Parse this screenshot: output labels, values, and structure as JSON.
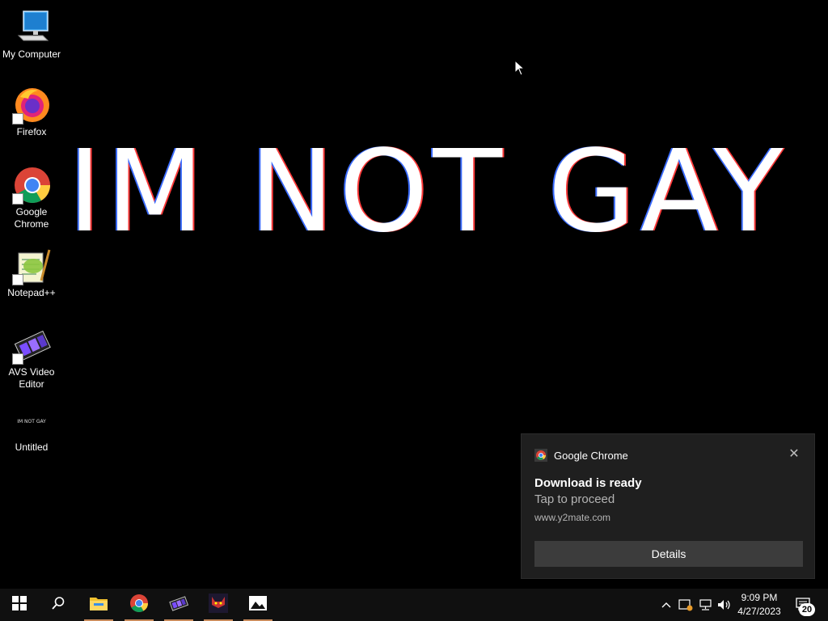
{
  "wallpaper": {
    "text": "IM NOT GAY"
  },
  "desktop_icons": [
    {
      "label": "My Computer",
      "icon": "computer-icon"
    },
    {
      "label": "Firefox",
      "icon": "firefox-icon"
    },
    {
      "label": "Google Chrome",
      "icon": "chrome-icon"
    },
    {
      "label": "Notepad++",
      "icon": "notepadpp-icon"
    },
    {
      "label": "AVS Video Editor",
      "icon": "avs-video-editor-icon"
    },
    {
      "label": "Untitled",
      "thumb_text": "IM NOT GAY",
      "icon": "image-file-icon"
    }
  ],
  "toast": {
    "app_name": "Google Chrome",
    "title": "Download is ready",
    "body": "Tap to proceed",
    "source": "www.y2mate.com",
    "button_label": "Details"
  },
  "taskbar": {
    "pinned": [
      "start-icon",
      "search-icon",
      "file-explorer-icon",
      "chrome-icon",
      "avs-video-icon",
      "nitw-icon",
      "photos-icon"
    ],
    "clock_time": "9:09 PM",
    "clock_date": "4/27/2023",
    "notification_count": "20",
    "accent_color": "#c88a5a"
  }
}
